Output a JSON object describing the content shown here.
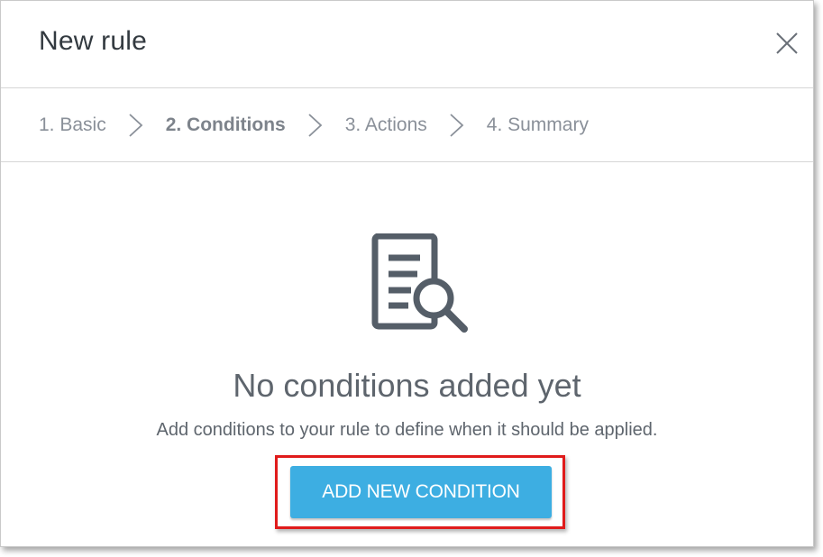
{
  "dialog": {
    "title": "New rule",
    "close_icon": "close-icon"
  },
  "steps": [
    {
      "label": "1. Basic",
      "active": false
    },
    {
      "label": "2. Conditions",
      "active": true
    },
    {
      "label": "3. Actions",
      "active": false
    },
    {
      "label": "4. Summary",
      "active": false
    }
  ],
  "empty_state": {
    "icon": "document-search-icon",
    "title": "No conditions added yet",
    "description": "Add conditions to your rule to define when it should be applied.",
    "button_label": "ADD NEW CONDITION"
  },
  "colors": {
    "accent": "#3daee2",
    "highlight": "#e01b1b",
    "icon": "#555e68"
  }
}
